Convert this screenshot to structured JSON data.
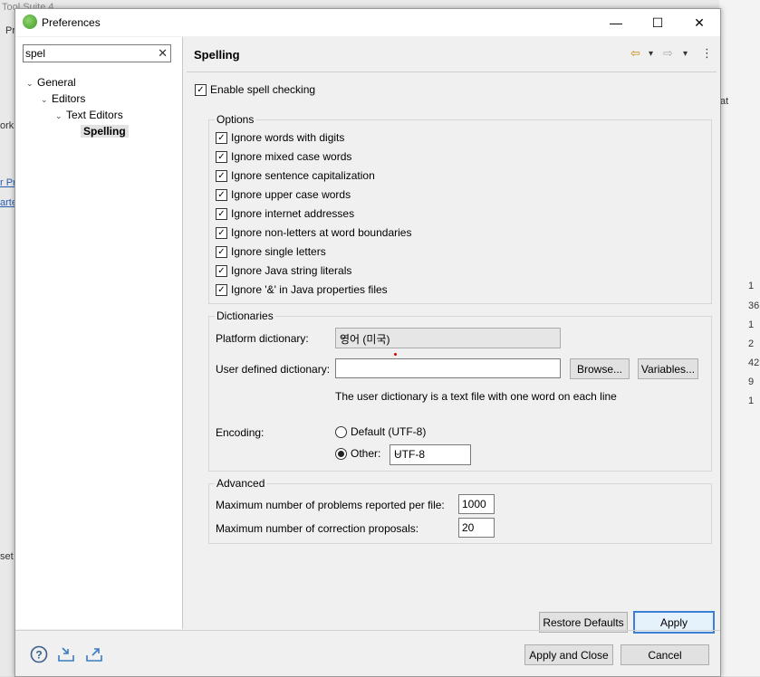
{
  "window": {
    "title": "Preferences",
    "minimize": "—",
    "maximize": "☐",
    "close": "✕"
  },
  "background": {
    "title_fragment": "Tool Suite 4",
    "menu_fragment": "Pr",
    "bits": [
      "ork",
      "r Pr",
      "arte",
      "at",
      "1",
      "36",
      "1",
      "2",
      "42",
      "9",
      "1",
      "set"
    ]
  },
  "filter": {
    "value": "spel",
    "clear": "✕"
  },
  "tree": [
    {
      "label": "General",
      "twisty": "⌄"
    },
    {
      "label": "Editors",
      "twisty": "⌄"
    },
    {
      "label": "Text Editors",
      "twisty": "⌄"
    },
    {
      "label": "Spelling",
      "twisty": ""
    }
  ],
  "page": {
    "title": "Spelling",
    "back": "⇦",
    "forward": "⇨",
    "menu": "▾",
    "more": "⋮"
  },
  "enable": {
    "label": "Enable spell checking",
    "checked": true
  },
  "options": {
    "title": "Options",
    "items": [
      "Ignore words with digits",
      "Ignore mixed case words",
      "Ignore sentence capitalization",
      "Ignore upper case words",
      "Ignore internet addresses",
      "Ignore non-letters at word boundaries",
      "Ignore single letters",
      "Ignore Java string literals",
      "Ignore '&' in Java properties files"
    ],
    "check": "✓"
  },
  "dictionaries": {
    "title": "Dictionaries",
    "platform_label": "Platform dictionary:",
    "platform_value": "영어 (미국)",
    "user_label": "User defined dictionary:",
    "user_value": "",
    "browse": "Browse...",
    "variables": "Variables...",
    "hint": "The user dictionary is a text file with one word on each line",
    "encoding_label": "Encoding:",
    "default_label": "Default (UTF-8)",
    "other_label": "Other:",
    "other_value": "UTF-8"
  },
  "advanced": {
    "title": "Advanced",
    "problems_label": "Maximum number of problems reported per file:",
    "problems_value": "1000",
    "proposals_label": "Maximum number of correction proposals:",
    "proposals_value": "20"
  },
  "buttons": {
    "restore": "Restore Defaults",
    "apply": "Apply",
    "apply_close": "Apply and Close",
    "cancel": "Cancel"
  },
  "footer_icons": [
    "help-icon",
    "import-icon",
    "export-icon"
  ]
}
